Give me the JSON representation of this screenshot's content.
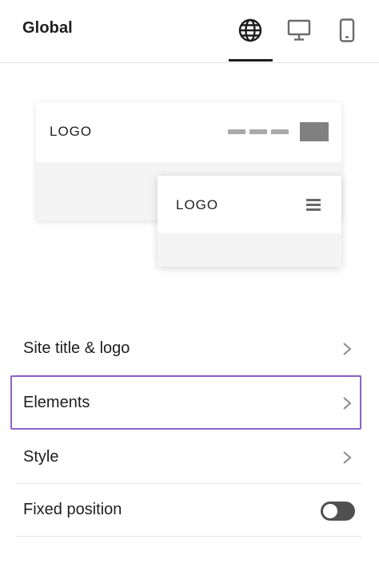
{
  "header": {
    "title": "Global",
    "views": [
      {
        "name": "globe-icon",
        "active": true
      },
      {
        "name": "desktop-icon",
        "active": false
      },
      {
        "name": "mobile-icon",
        "active": false
      }
    ]
  },
  "preview": {
    "desktop_logo": "LOGO",
    "mobile_logo": "LOGO"
  },
  "menu": {
    "items": [
      {
        "label": "Site title & logo"
      },
      {
        "label": "Elements"
      },
      {
        "label": "Style"
      },
      {
        "label": "Fixed position"
      }
    ],
    "fixed_position_enabled": false
  },
  "colors": {
    "selection_border": "#8a63c9",
    "toggle_off": "#505050",
    "text": "#1e1e1e"
  }
}
